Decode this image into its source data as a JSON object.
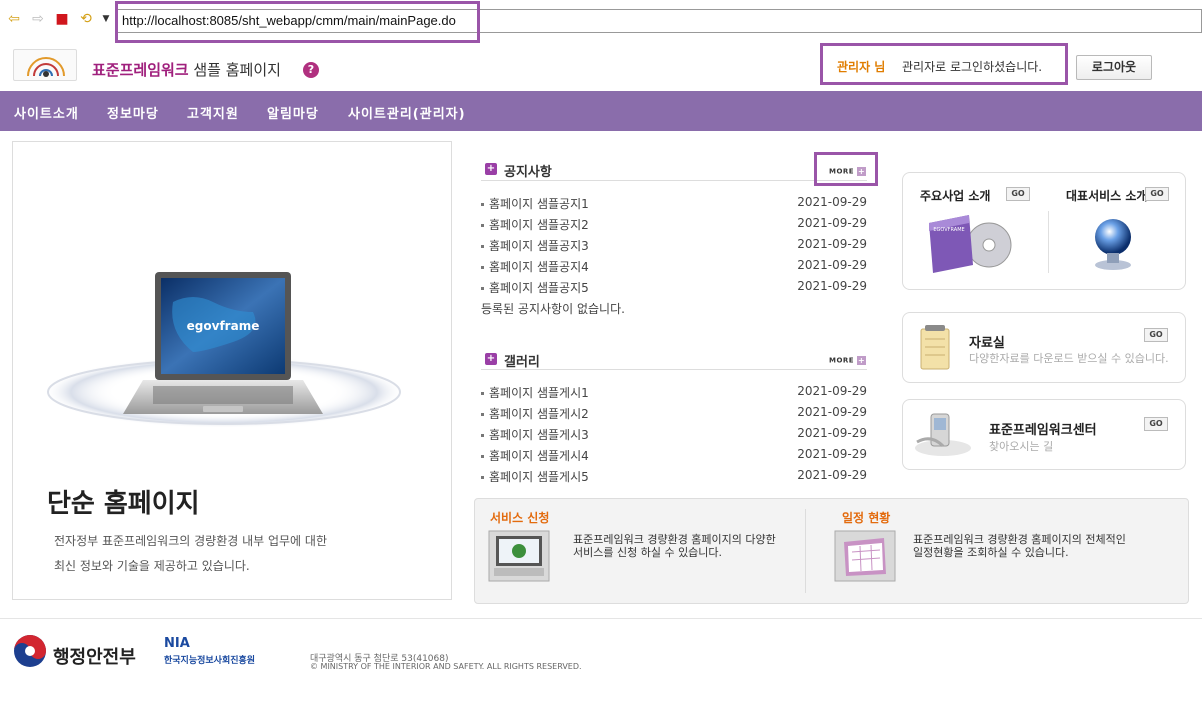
{
  "browser": {
    "url": "http://localhost:8085/sht_webapp/cmm/main/mainPage.do",
    "icons": [
      "back-arrow-icon",
      "forward-arrow-icon",
      "stop-icon",
      "refresh-icon",
      "dropdown-arrow-icon"
    ]
  },
  "header": {
    "title_accent": "표준프레임워크",
    "title_rest": " 샘플 홈페이지",
    "help_glyph": "?",
    "admin_name": "관리자 님",
    "login_msg": "관리자로 로그인하셨습니다.",
    "logout_label": "로그아웃"
  },
  "nav": {
    "items": [
      "사이트소개",
      "정보마당",
      "고객지원",
      "알림마당",
      "사이트관리(관리자)"
    ]
  },
  "hero": {
    "screen_text": "egovframe",
    "title": "단순 홈페이지",
    "desc1": "전자정부 표준프레임워크의 경량환경 내부 업무에 대한",
    "desc2": "최신 정보와 기술을 제공하고 있습니다."
  },
  "notice": {
    "title": "공지사항",
    "more": "MORE",
    "rows": [
      {
        "title": "홈페이지 샘플공지1",
        "date": "2021-09-29"
      },
      {
        "title": "홈페이지 샘플공지2",
        "date": "2021-09-29"
      },
      {
        "title": "홈페이지 샘플공지3",
        "date": "2021-09-29"
      },
      {
        "title": "홈페이지 샘플공지4",
        "date": "2021-09-29"
      },
      {
        "title": "홈페이지 샘플공지5",
        "date": "2021-09-29"
      }
    ],
    "empty": "등록된 공지사항이 없습니다."
  },
  "gallery": {
    "title": "갤러리",
    "more": "MORE",
    "rows": [
      {
        "title": "홈페이지 샘플게시1",
        "date": "2021-09-29"
      },
      {
        "title": "홈페이지 샘플게시2",
        "date": "2021-09-29"
      },
      {
        "title": "홈페이지 샘플게시3",
        "date": "2021-09-29"
      },
      {
        "title": "홈페이지 샘플게시4",
        "date": "2021-09-29"
      },
      {
        "title": "홈페이지 샘플게시5",
        "date": "2021-09-29"
      }
    ]
  },
  "cards": {
    "main_business": "주요사업 소개",
    "rep_service": "대표서비스 소개",
    "go": "GO",
    "box_text": "EGOVFRAME",
    "archive_title": "자료실",
    "archive_sub": "다양한자료를 다운로드 받으실 수 있습니다.",
    "center_title": "표준프레임워크센터",
    "center_sub": "찾아오시는 길"
  },
  "services": {
    "apply_title": "서비스 신청",
    "apply_desc": "표준프레임워크 경량환경 홈페이지의 다양한 서비스를 신청 하실 수 있습니다.",
    "schedule_title": "일정 현황",
    "schedule_desc": "표준프레임워크 경량환경 홈페이지의 전체적인 일정현황을 조회하실 수 있습니다."
  },
  "footer": {
    "mois": "행정안전부",
    "nia_en": "NIA",
    "nia_ko": "한국지능정보사회진흥원",
    "address": "대구광역시 동구 첨단로 53(41068)",
    "copyright": "© MINISTRY OF THE INTERIOR AND SAFETY. ALL RIGHTS RESERVED."
  },
  "colors": {
    "nav_bg": "#8a6dab",
    "accent_purple": "#9a55a8",
    "title_accent": "#a0207d",
    "admin_orange": "#e07d00",
    "service_orange": "#e36b0e"
  }
}
